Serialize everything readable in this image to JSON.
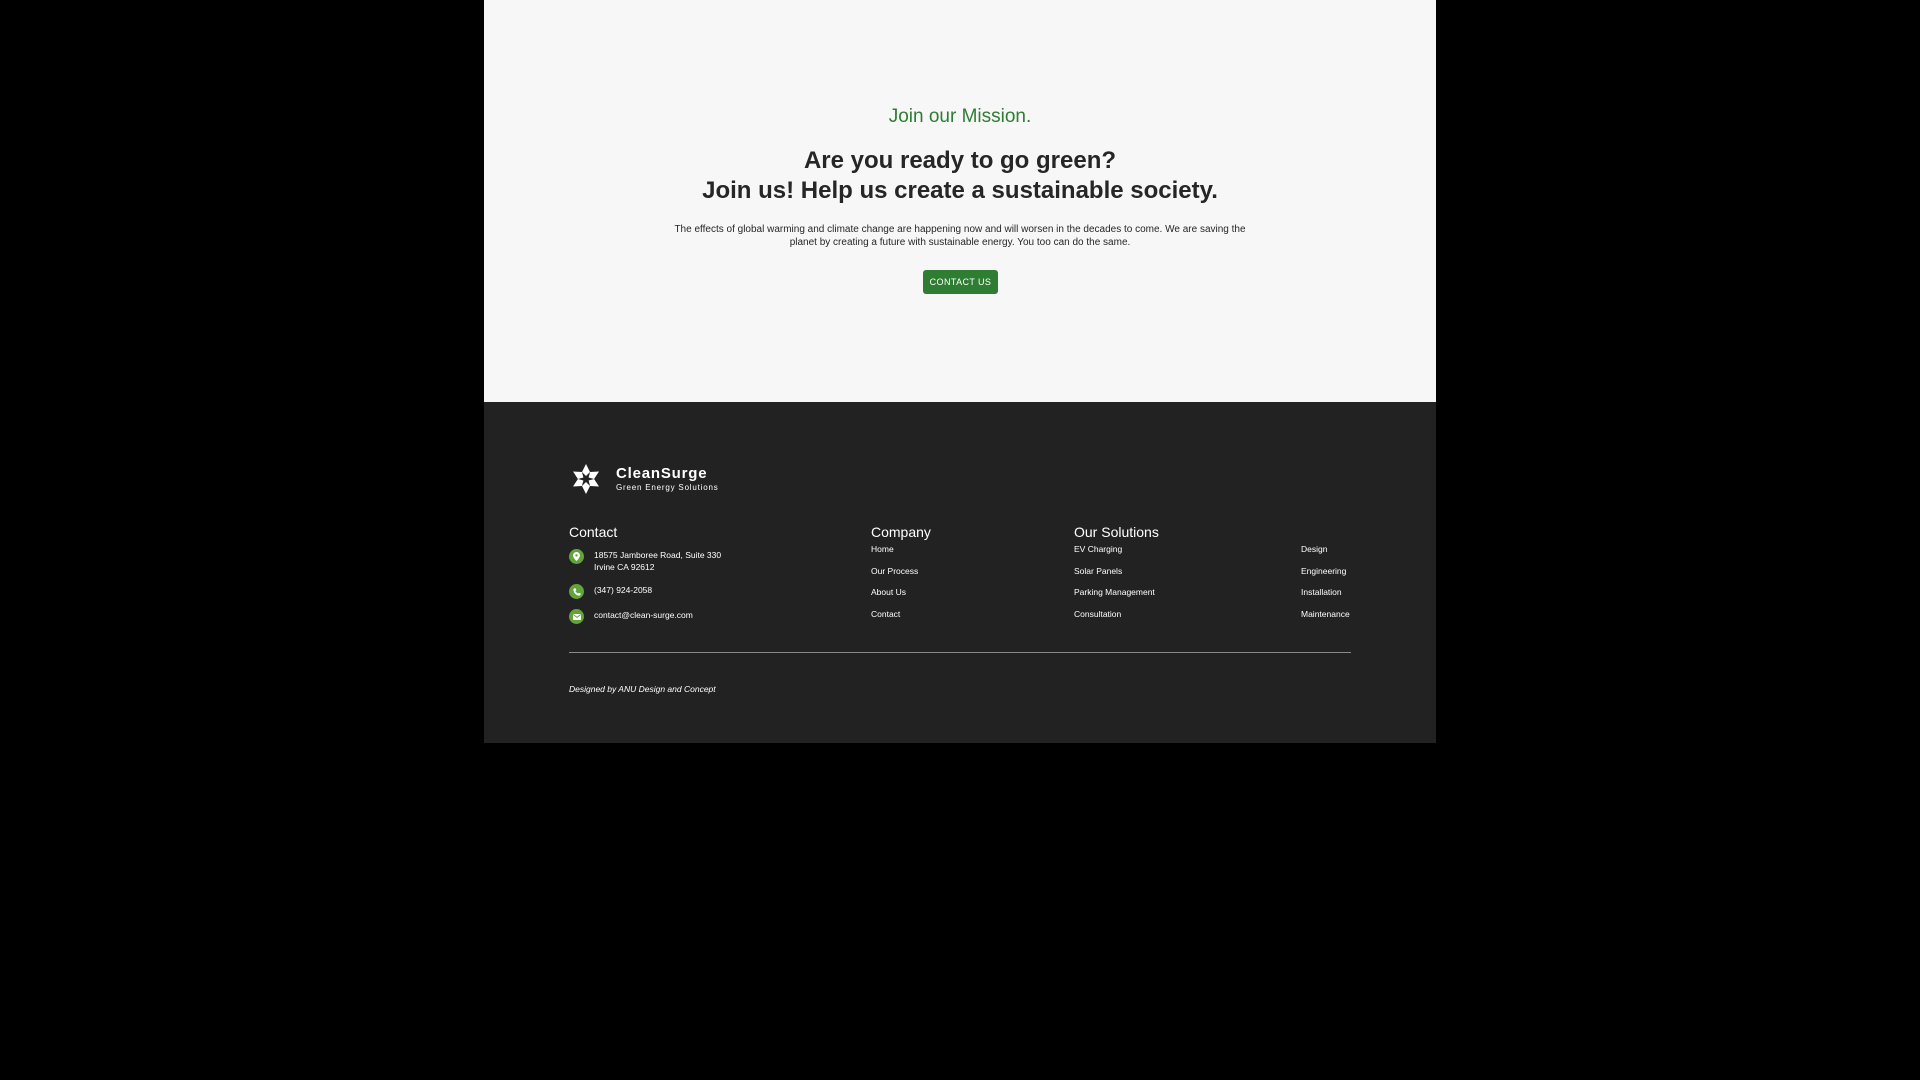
{
  "hero": {
    "eyebrow": "Join our Mission.",
    "headline_line1": "Are you ready to go green?",
    "headline_line2": "Join us! Help us create a sustainable society.",
    "body": "The effects of global warming and climate change are happening now and will worsen in the decades to come. We are saving the planet by creating a future with sustainable energy. You too can do the same.",
    "cta_label": "CONTACT US"
  },
  "footer": {
    "logo": {
      "name": "CleanSurge",
      "tagline": "Green Energy Solutions"
    },
    "contact": {
      "title": "Contact",
      "address_line1": "18575 Jamboree Road, Suite 330",
      "address_line2": "Irvine CA 92612",
      "phone": "(347) 924-2058",
      "email": "contact@clean-surge.com",
      "icons": [
        "map-pin-icon",
        "phone-icon",
        "mail-icon"
      ]
    },
    "company": {
      "title": "Company",
      "links": [
        "Home",
        "Our Process",
        "About Us",
        "Contact"
      ]
    },
    "solutions": {
      "title": "Our Solutions",
      "links_col1": [
        "EV Charging",
        "Solar Panels",
        "Parking Management",
        "Consultation"
      ],
      "links_col2": [
        "Design",
        "Engineering",
        "Installation",
        "Maintenance"
      ]
    },
    "credit": "Designed by ANU Design and Concept"
  },
  "colors": {
    "accent": "#2e7d32",
    "icon_green": "#62a33a",
    "footer_bg": "#222222",
    "hero_bg": "#f7f7f7",
    "outer_bg": "#000000"
  }
}
